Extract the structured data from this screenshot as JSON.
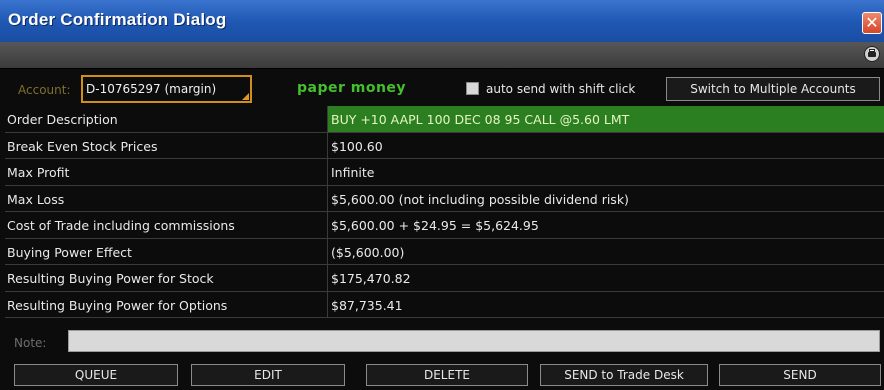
{
  "window": {
    "title": "Order Confirmation Dialog",
    "close_glyph": "✕"
  },
  "account": {
    "label": "Account:",
    "value": "D-10765297 (margin)",
    "paper_money": "paper money",
    "auto_send_label": "auto send with shift click",
    "auto_send_checked": false,
    "switch_button": "Switch to Multiple Accounts"
  },
  "order": {
    "rows": [
      {
        "label": "Order Description",
        "value": "BUY +10 AAPL 100 DEC 08 95 CALL @5.60 LMT"
      },
      {
        "label": "Break Even Stock Prices",
        "value": "$100.60"
      },
      {
        "label": "Max Profit",
        "value": "Infinite"
      },
      {
        "label": "Max Loss",
        "value": "$5,600.00 (not including possible dividend risk)"
      },
      {
        "label": "Cost of Trade including commissions",
        "value": "$5,600.00 + $24.95 = $5,624.95"
      },
      {
        "label": "Buying Power Effect",
        "value": "($5,600.00)"
      },
      {
        "label": "Resulting Buying Power for Stock",
        "value": "$175,470.82"
      },
      {
        "label": "Resulting Buying Power for Options",
        "value": "$87,735.41"
      }
    ]
  },
  "note": {
    "label": "Note:",
    "value": ""
  },
  "buttons": {
    "queue": "QUEUE",
    "edit": "EDIT",
    "delete": "DELETE",
    "send_to_desk": "SEND to Trade Desk",
    "send": "SEND"
  },
  "colors": {
    "title_bar": "#1e57b2",
    "account_border": "#d28d1b",
    "paper_money": "#45c02d",
    "description_highlight": "#2b7f21"
  },
  "icons": {
    "close": "close-icon",
    "print": "print-icon"
  }
}
